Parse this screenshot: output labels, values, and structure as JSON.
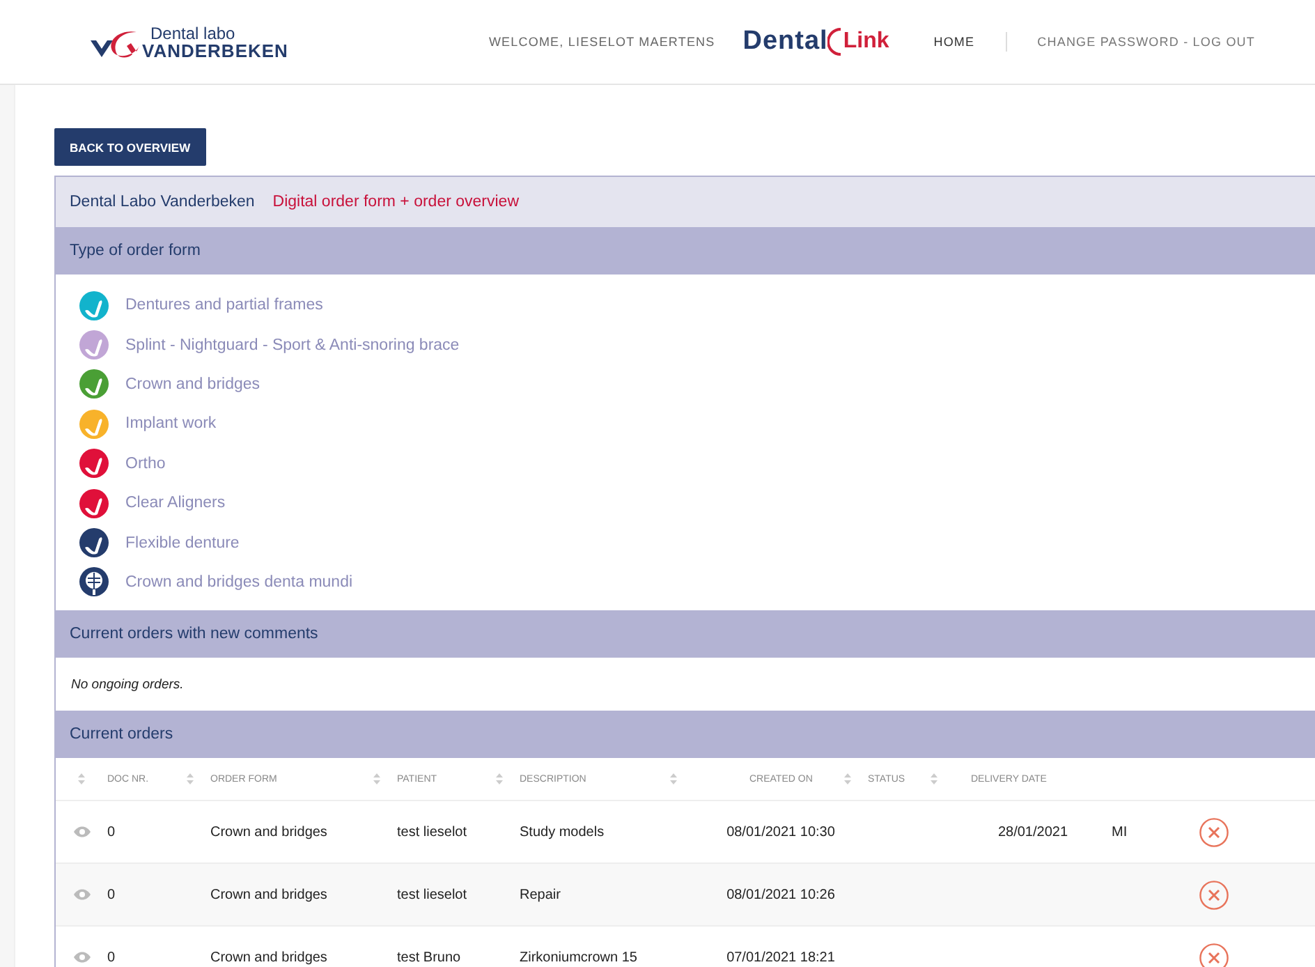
{
  "header": {
    "logo": {
      "line_1": "Dental labo",
      "line_2": "VANDERBEKEN"
    },
    "welcome": "WELCOME, LIESELOT MAERTENS",
    "brand": {
      "part_1": "Dental",
      "part_2": "Link"
    },
    "nav": [
      "HOME",
      "CHANGE PASSWORD - LOG OUT"
    ]
  },
  "back_button": "BACK TO OVERVIEW",
  "panel": {
    "title": "Dental Labo Vanderbeken",
    "subtitle": "Digital order form + order overview"
  },
  "order_forms": {
    "heading": "Type of order form",
    "items": [
      {
        "label": "Dentures and partial frames",
        "color": "#12b3cc",
        "kind": "tooth"
      },
      {
        "label": "Splint - Nightguard - Sport & Anti-snoring brace",
        "color": "#c1a6d6",
        "kind": "tooth"
      },
      {
        "label": "Crown and bridges",
        "color": "#4a9f35",
        "kind": "tooth"
      },
      {
        "label": "Implant work",
        "color": "#f8b22a",
        "kind": "tooth"
      },
      {
        "label": "Ortho",
        "color": "#e0103a",
        "kind": "tooth"
      },
      {
        "label": "Clear Aligners",
        "color": "#e0103a",
        "kind": "tooth"
      },
      {
        "label": "Flexible denture",
        "color": "#243c6c",
        "kind": "tooth"
      },
      {
        "label": "Crown and bridges denta mundi",
        "color": "#243c6c",
        "kind": "globe"
      }
    ]
  },
  "comments": {
    "heading": "Current orders with new comments",
    "empty": "No ongoing orders."
  },
  "orders": {
    "heading": "Current orders",
    "columns": [
      "DOC NR.",
      "ORDER FORM",
      "PATIENT",
      "DESCRIPTION",
      "CREATED ON",
      "STATUS",
      "DELIVERY DATE"
    ],
    "rows": [
      {
        "doc": "0",
        "form": "Crown and bridges",
        "patient": "test lieselot",
        "description": "Study models",
        "created": "08/01/2021 10:30",
        "delivery": "28/01/2021",
        "column_8": "MI"
      },
      {
        "doc": "0",
        "form": "Crown and bridges",
        "patient": "test lieselot",
        "description": "Repair",
        "created": "08/01/2021 10:26"
      },
      {
        "doc": "0",
        "form": "Crown and bridges",
        "patient": "test Bruno",
        "description": "Zirkoniumcrown 15",
        "created": "07/01/2021 18:21"
      }
    ]
  }
}
